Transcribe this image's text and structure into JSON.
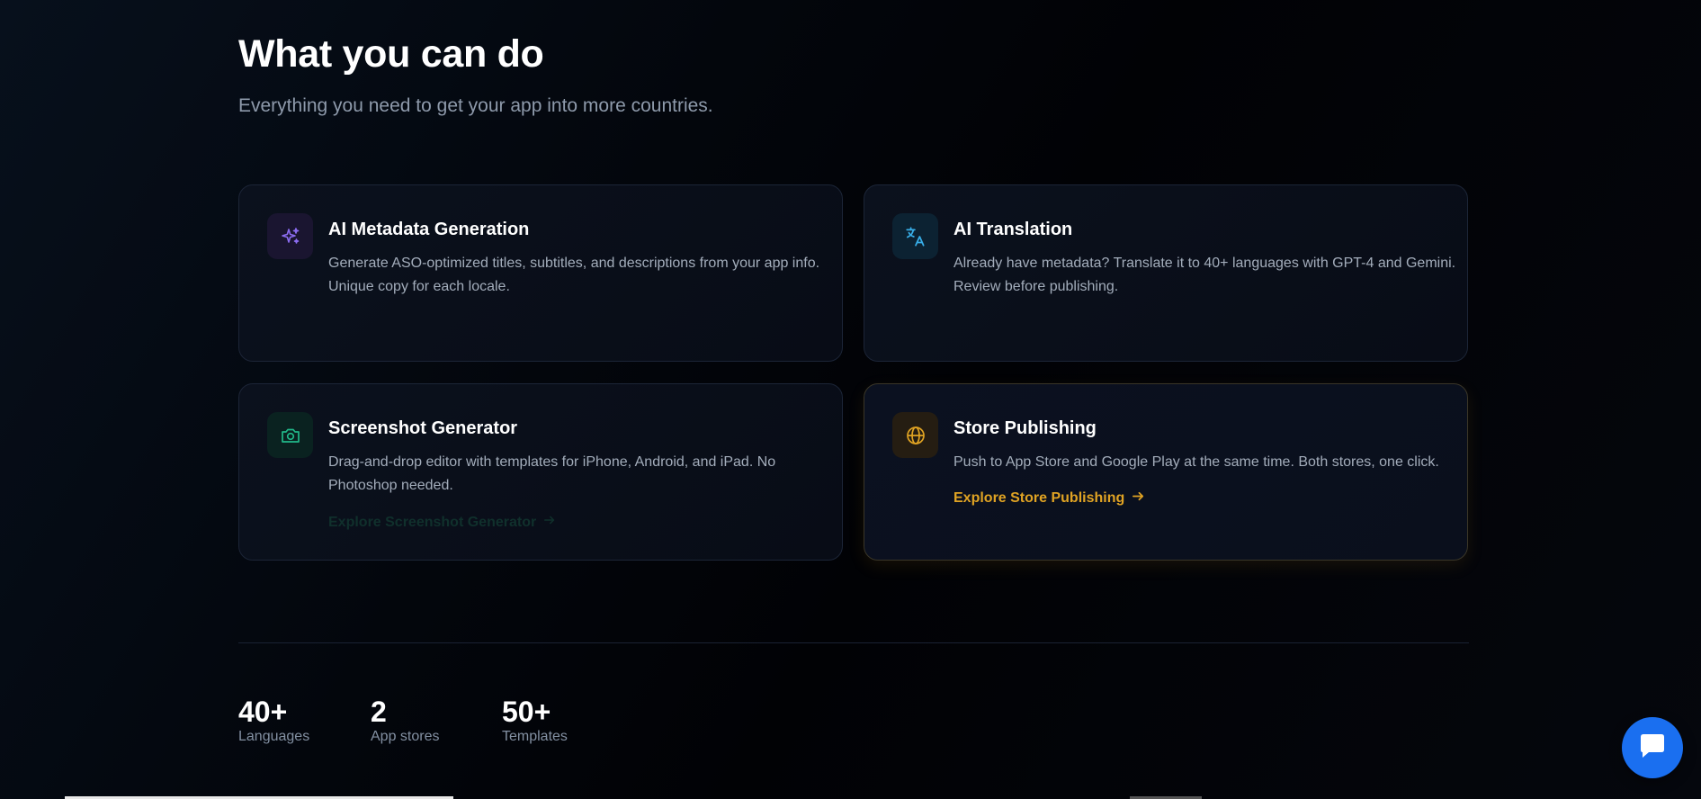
{
  "section": {
    "title": "What you can do",
    "subtitle": "Everything you need to get your app into more countries."
  },
  "features": [
    {
      "title": "AI Metadata Generation",
      "description": "Generate ASO-optimized titles, subtitles, and descriptions from your app info. Unique copy for each locale.",
      "icon": "sparkles-icon",
      "accent": "#8b6cf0"
    },
    {
      "title": "AI Translation",
      "description": "Already have metadata? Translate it to 40+ languages with GPT-4 and Gemini. Review before publishing.",
      "icon": "translate-icon",
      "accent": "#38aee8"
    },
    {
      "title": "Screenshot Generator",
      "description": "Drag-and-drop editor with templates for iPhone, Android, and iPad. No Photoshop needed.",
      "link": "Explore Screenshot Generator",
      "icon": "camera-icon",
      "accent": "#21b889"
    },
    {
      "title": "Store Publishing",
      "description": "Push to App Store and Google Play at the same time. Both stores, one click.",
      "link": "Explore Store Publishing",
      "icon": "globe-icon",
      "accent": "#e0a323"
    }
  ],
  "stats": [
    {
      "value": "40+",
      "label": "Languages"
    },
    {
      "value": "2",
      "label": "App stores"
    },
    {
      "value": "50+",
      "label": "Templates"
    }
  ],
  "chat": {
    "icon": "chat-bubble-icon",
    "color": "#1a6ff0"
  }
}
